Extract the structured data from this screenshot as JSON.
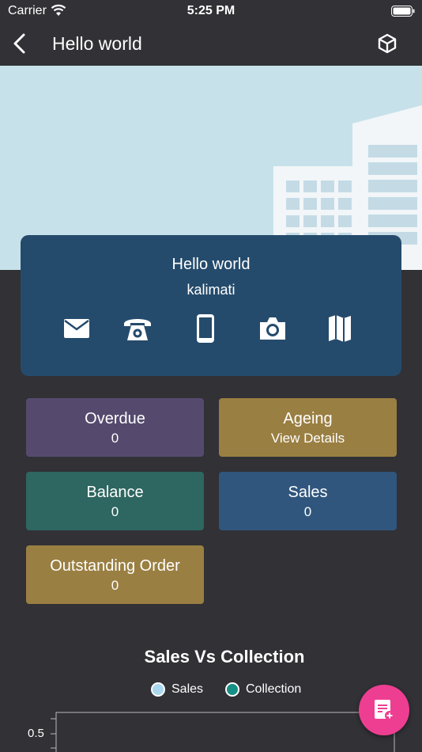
{
  "status_bar": {
    "carrier": "Carrier",
    "time": "5:25 PM"
  },
  "header": {
    "title": "Hello world",
    "back_icon": "chevron-left-icon",
    "action_icon": "cube-icon"
  },
  "profile": {
    "name": "Hello world",
    "subtitle": "kalimati",
    "actions": [
      "mail-icon",
      "phone-icon",
      "mobile-icon",
      "camera-icon",
      "map-icon"
    ]
  },
  "tiles": [
    {
      "title": "Overdue",
      "value": "0",
      "color": "#554a6e"
    },
    {
      "title": "Ageing",
      "value": "View Details",
      "color": "#9a7f42"
    },
    {
      "title": "Balance",
      "value": "0",
      "color": "#2e6661"
    },
    {
      "title": "Sales",
      "value": "0",
      "color": "#30567d"
    },
    {
      "title": "Outstanding Order",
      "value": "0",
      "color": "#9a7f42"
    }
  ],
  "chart": {
    "title": "Sales Vs Collection",
    "legend": [
      {
        "label": "Sales",
        "color": "#a9d8ef"
      },
      {
        "label": "Collection",
        "color": "#168f86"
      }
    ],
    "y_tick": "0.5"
  },
  "colors": {
    "background": "#313136",
    "hero": "#c7e1ea",
    "card": "#254b6c",
    "fab": "#ee3e91"
  },
  "fab": {
    "icon": "note-add-icon"
  }
}
